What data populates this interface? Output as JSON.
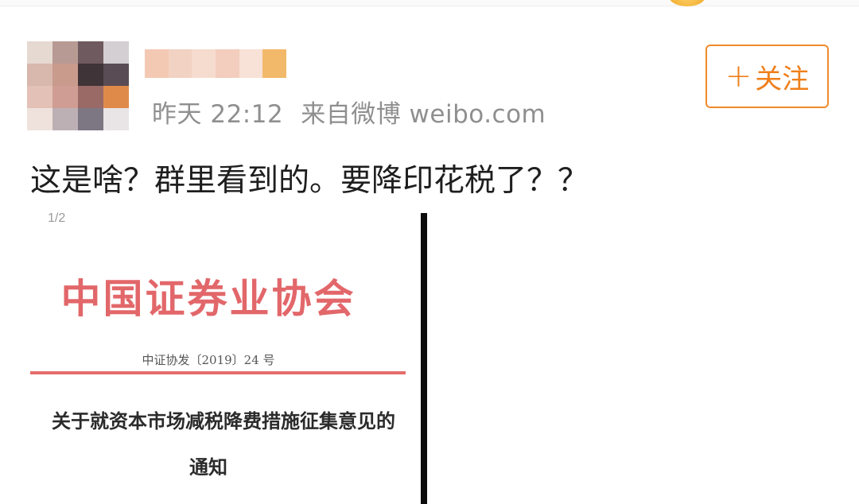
{
  "post": {
    "meta_time": "昨天 22:12",
    "meta_source": "来自微博 weibo.com",
    "follow_icon": "plus-icon",
    "follow_plus": "+",
    "follow_label": "关注",
    "text": "这是啥？群里看到的。要降印花税了？？"
  },
  "document_image": {
    "page_indicator": "1/2",
    "organization": "中国证券业协会",
    "document_number": "中证协发〔2019〕24 号",
    "title_line1": "关于就资本市场减税降费措施征集意见的",
    "title_line2": "通知"
  },
  "colors": {
    "accent": "#ef7f1a",
    "meta_text": "#8f8f8f",
    "doc_red": "#e2676a"
  }
}
